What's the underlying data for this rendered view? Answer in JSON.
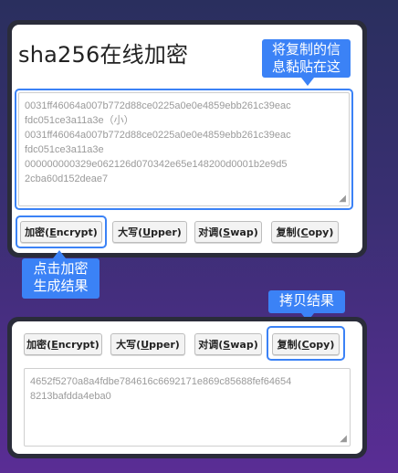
{
  "title": "sha256在线加密",
  "top_tooltip": {
    "line1": "将复制的信",
    "line2": "息黏贴在这"
  },
  "input_text": "0031ff46064a007b772d88ce0225a0e0e4859ebb261c39eacfdc051ce3a11a3e（小）0031ff46064a007b772d88ce0225a0e0e4859ebb261c39eacfdc051ce3a11a3e000000000329e062126d070342e65e148200d0001b2e9d52cba60d152deae7",
  "input_lines": [
    "0031ff46064a007b772d88ce0225a0e0e4859ebb261c39eac",
    "fdc051ce3a11a3e（小）",
    "0031ff46064a007b772d88ce0225a0e0e4859ebb261c39eac",
    "fdc051ce3a11a3e",
    "000000000329e062126d070342e65e148200d0001b2e9d5",
    "2cba60d152deae7"
  ],
  "buttons": {
    "encrypt": {
      "pre": "加密(",
      "key": "E",
      "post": "ncrypt)"
    },
    "upper": {
      "pre": "大写(",
      "key": "U",
      "post": "pper)"
    },
    "swap": {
      "pre": "对调(",
      "key": "S",
      "post": "wap)"
    },
    "copy": {
      "pre": "复制(",
      "key": "C",
      "post": "opy)"
    }
  },
  "encrypt_tooltip": {
    "line1": "点击加密",
    "line2": "生成结果"
  },
  "copy_tooltip": "拷贝结果",
  "output_lines": [
    "4652f5270a8a4fdbe784616c6692171e869c85688fef64654",
    "8213bafdda4eba0"
  ],
  "colors": {
    "accent": "#3b82f6",
    "panel": "#2a2c3a"
  }
}
